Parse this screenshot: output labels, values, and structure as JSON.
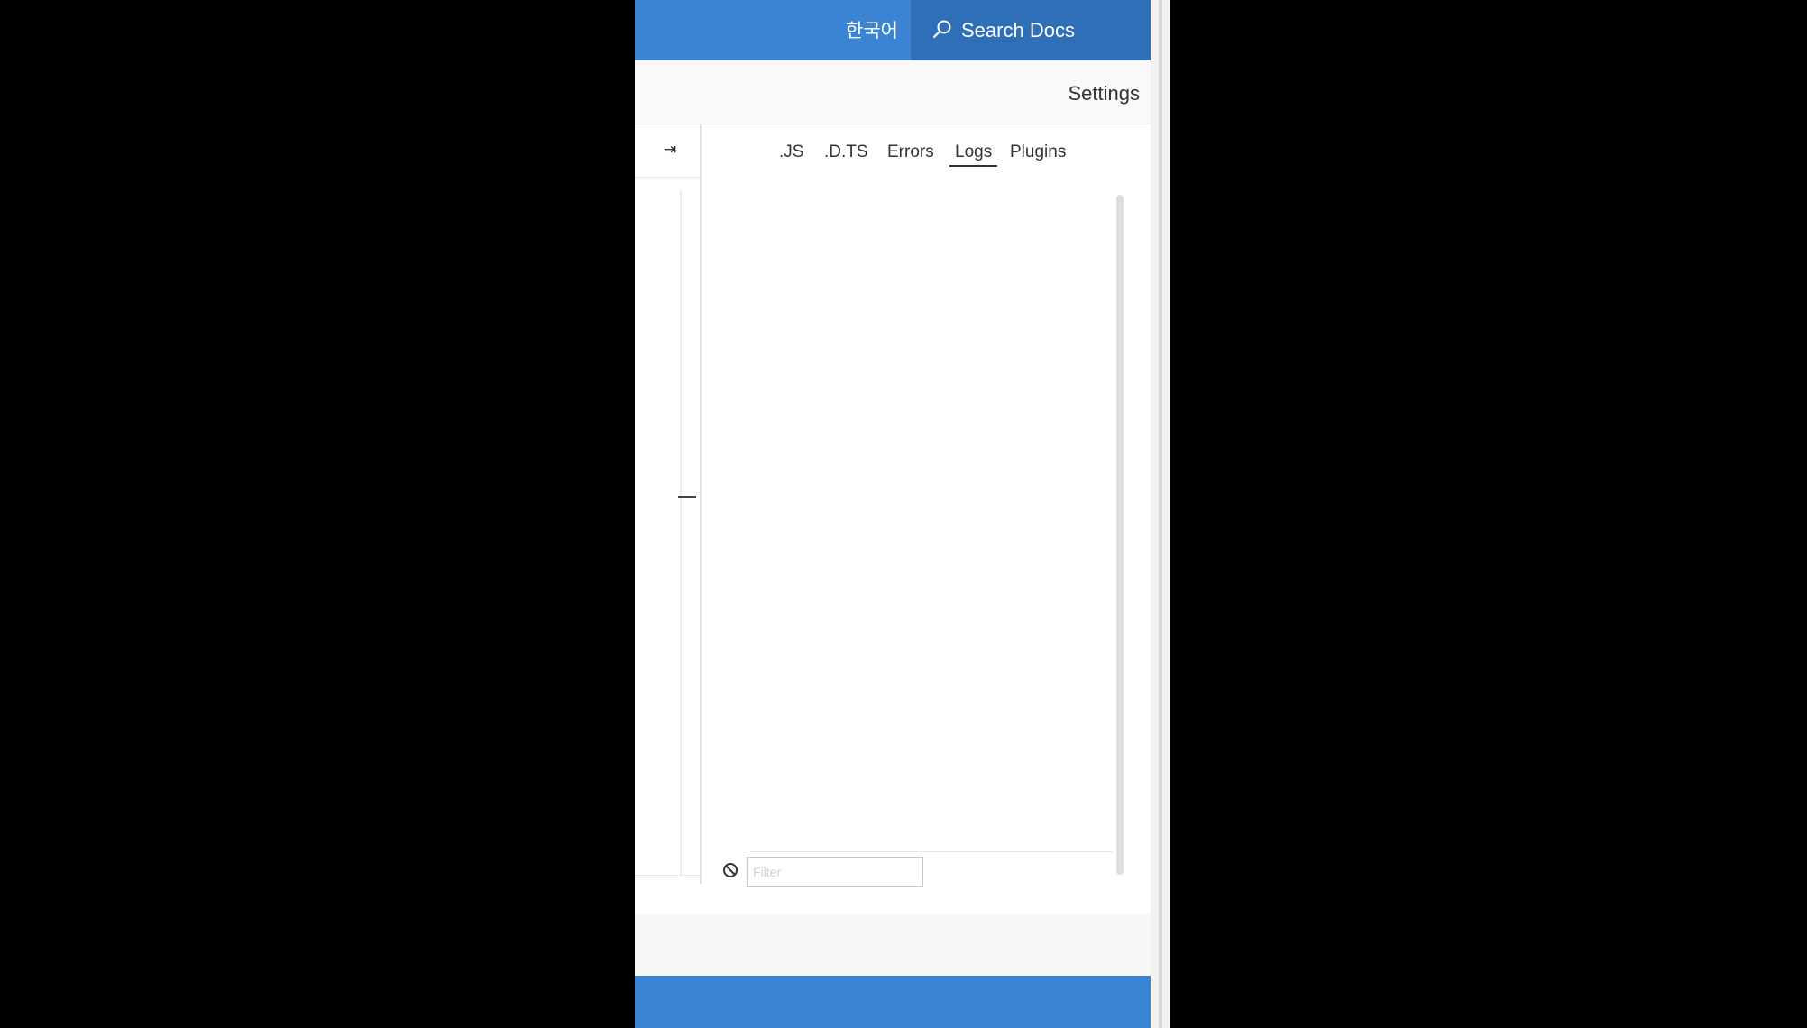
{
  "header": {
    "language": "한국어",
    "search_label": "Search Docs"
  },
  "subbar": {
    "settings_label": "Settings"
  },
  "editor": {
    "collapse_icon": "collapse-right-icon"
  },
  "output": {
    "tabs": [
      {
        "label": ".JS",
        "active": false
      },
      {
        "label": ".D.TS",
        "active": false
      },
      {
        "label": "Errors",
        "active": false
      },
      {
        "label": "Logs",
        "active": true
      },
      {
        "label": "Plugins",
        "active": false
      }
    ],
    "filter_placeholder": "Filter",
    "clear_icon": "clear-logs-icon"
  },
  "colors": {
    "brand_blue": "#3a84d3",
    "search_bg": "#2f6fb8"
  }
}
